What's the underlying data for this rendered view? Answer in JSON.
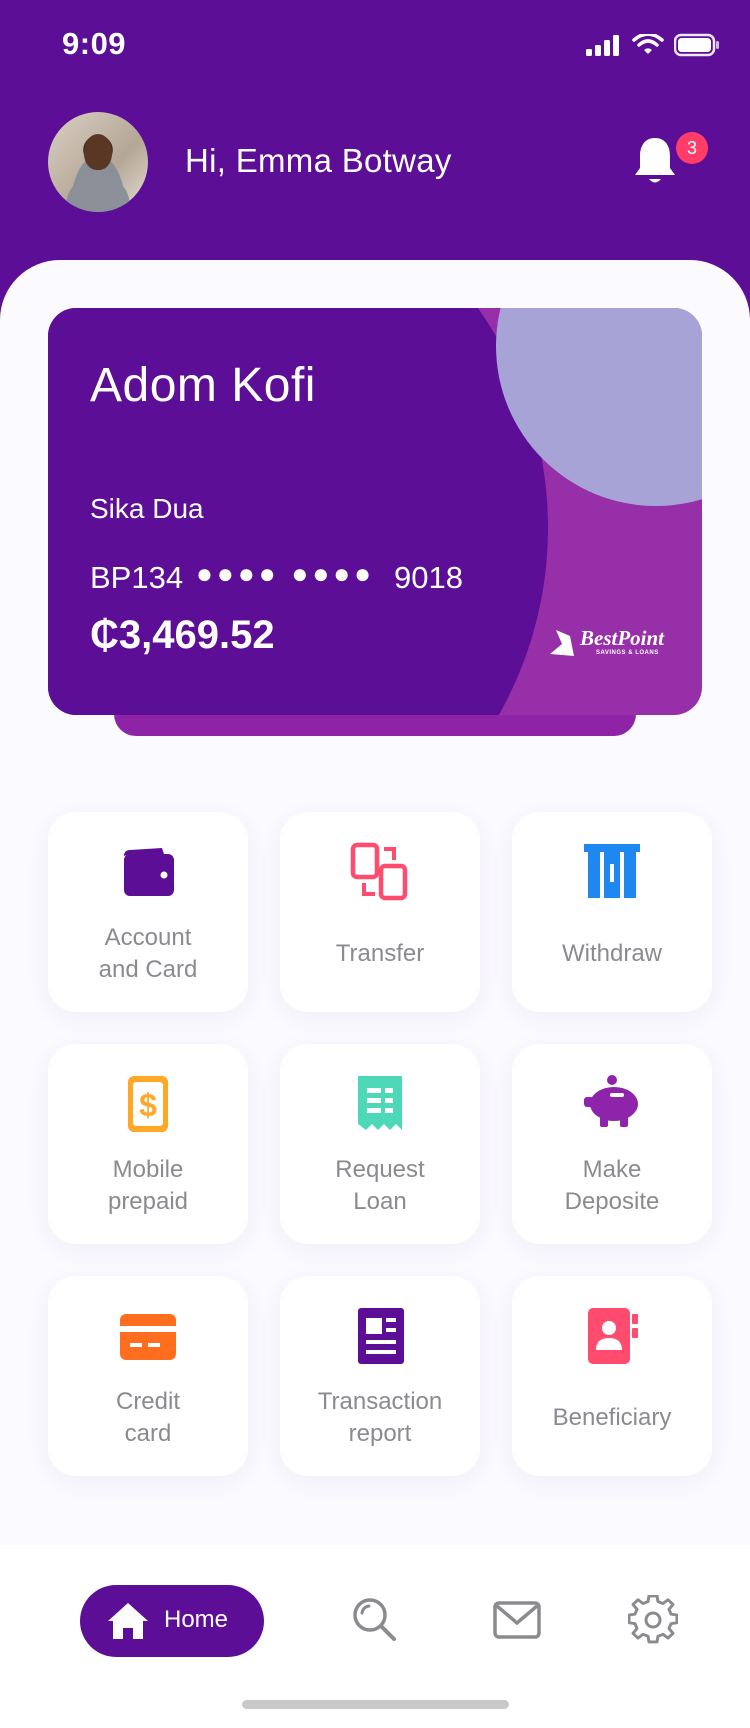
{
  "status_bar": {
    "time": "9:09"
  },
  "header": {
    "greeting": "Hi, Emma Botway",
    "notification_count": "3"
  },
  "card": {
    "holder_name": "Adom Kofi",
    "subtitle": "Sika Dua",
    "number_prefix": "BP134",
    "number_mask": "●●●● ●●●●",
    "number_suffix": "9018",
    "balance": "₵3,469.52",
    "logo_name": "BestPoint",
    "logo_subtitle": "SAVINGS & LOANS"
  },
  "actions": [
    {
      "label": "Account\nand Card",
      "icon": "wallet-icon",
      "color": "#5c0e96"
    },
    {
      "label": "Transfer",
      "icon": "transfer-icon",
      "color": "#ff4b6e"
    },
    {
      "label": "Withdraw",
      "icon": "atm-icon",
      "color": "#1e88f0"
    },
    {
      "label": "Mobile\nprepaid",
      "icon": "dollar-phone-icon",
      "color": "#ffa726"
    },
    {
      "label": "Request\nLoan",
      "icon": "receipt-icon",
      "color": "#4dd9b8"
    },
    {
      "label": "Make\nDeposite",
      "icon": "piggy-bank-icon",
      "color": "#8e24aa"
    },
    {
      "label": "Credit\ncard",
      "icon": "credit-card-icon",
      "color": "#ff6d1f"
    },
    {
      "label": "Transaction\nreport",
      "icon": "report-icon",
      "color": "#5c0e96"
    },
    {
      "label": "Beneficiary",
      "icon": "contact-book-icon",
      "color": "#ff4b6e"
    }
  ],
  "bottom_nav": {
    "home_label": "Home",
    "items": [
      "home-icon",
      "search-icon",
      "mail-icon",
      "settings-icon"
    ]
  },
  "colors": {
    "primary": "#5c0e96",
    "accent": "#ff3f6c",
    "card_secondary": "#962fa8",
    "card_circle": "#a8a3d6"
  }
}
